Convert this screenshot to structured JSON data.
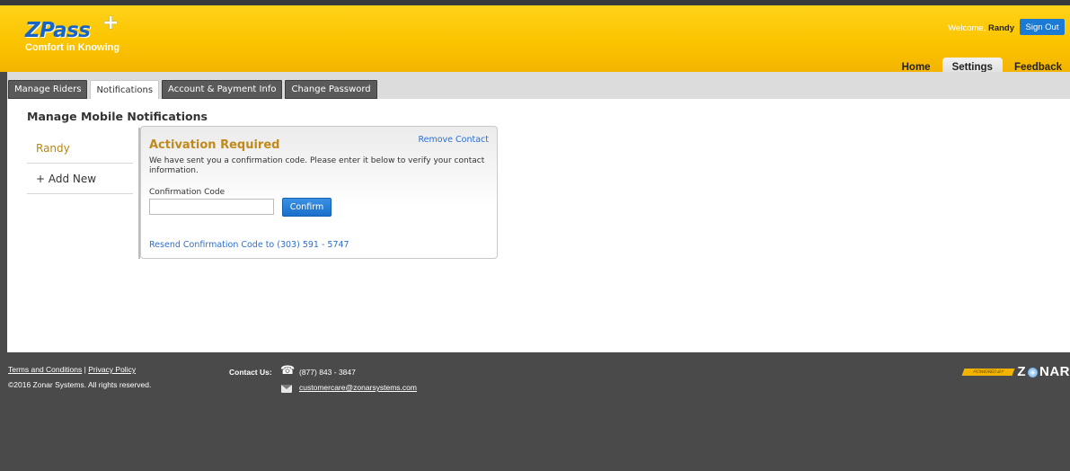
{
  "brand": {
    "logo_text": "ZPass",
    "logo_plus": "+",
    "tagline": "Comfort in Knowing",
    "accent_color": "#fbc400",
    "link_color": "#2e6fcf"
  },
  "header": {
    "welcome_prefix": "Welcome,",
    "user_name": "Randy",
    "sign_out": "Sign Out",
    "nav": [
      {
        "label": "Home",
        "active": false
      },
      {
        "label": "Settings",
        "active": true
      },
      {
        "label": "Feedback",
        "active": false
      }
    ]
  },
  "subtabs": [
    {
      "label": "Manage Riders",
      "active": false
    },
    {
      "label": "Notifications",
      "active": true
    },
    {
      "label": "Account & Payment Info",
      "active": false
    },
    {
      "label": "Change Password",
      "active": false
    }
  ],
  "main": {
    "title": "Manage Mobile Notifications",
    "contacts": [
      {
        "label": "Randy",
        "selected": true
      },
      {
        "label": "+ Add New",
        "selected": false
      }
    ],
    "card": {
      "remove_link": "Remove Contact",
      "heading": "Activation Required",
      "message": "We have sent you a confirmation code. Please enter it below to verify your contact information.",
      "code_label": "Confirmation Code",
      "code_value": "",
      "confirm_button": "Confirm",
      "resend_link": "Resend Confirmation Code to (303) 591 - 5747"
    }
  },
  "footer": {
    "terms": "Terms and Conditions",
    "separator": "|",
    "privacy": "Privacy Policy",
    "copyright": "©2016 Zonar Systems. All rights reserved.",
    "contact_label": "Contact Us:",
    "phone": "(877) 843 - 3847",
    "email": "customercare@zonarsystems.com",
    "powered_by": "POWERED BY",
    "powered_brand_start": "Z",
    "powered_brand_end": "NAR"
  }
}
